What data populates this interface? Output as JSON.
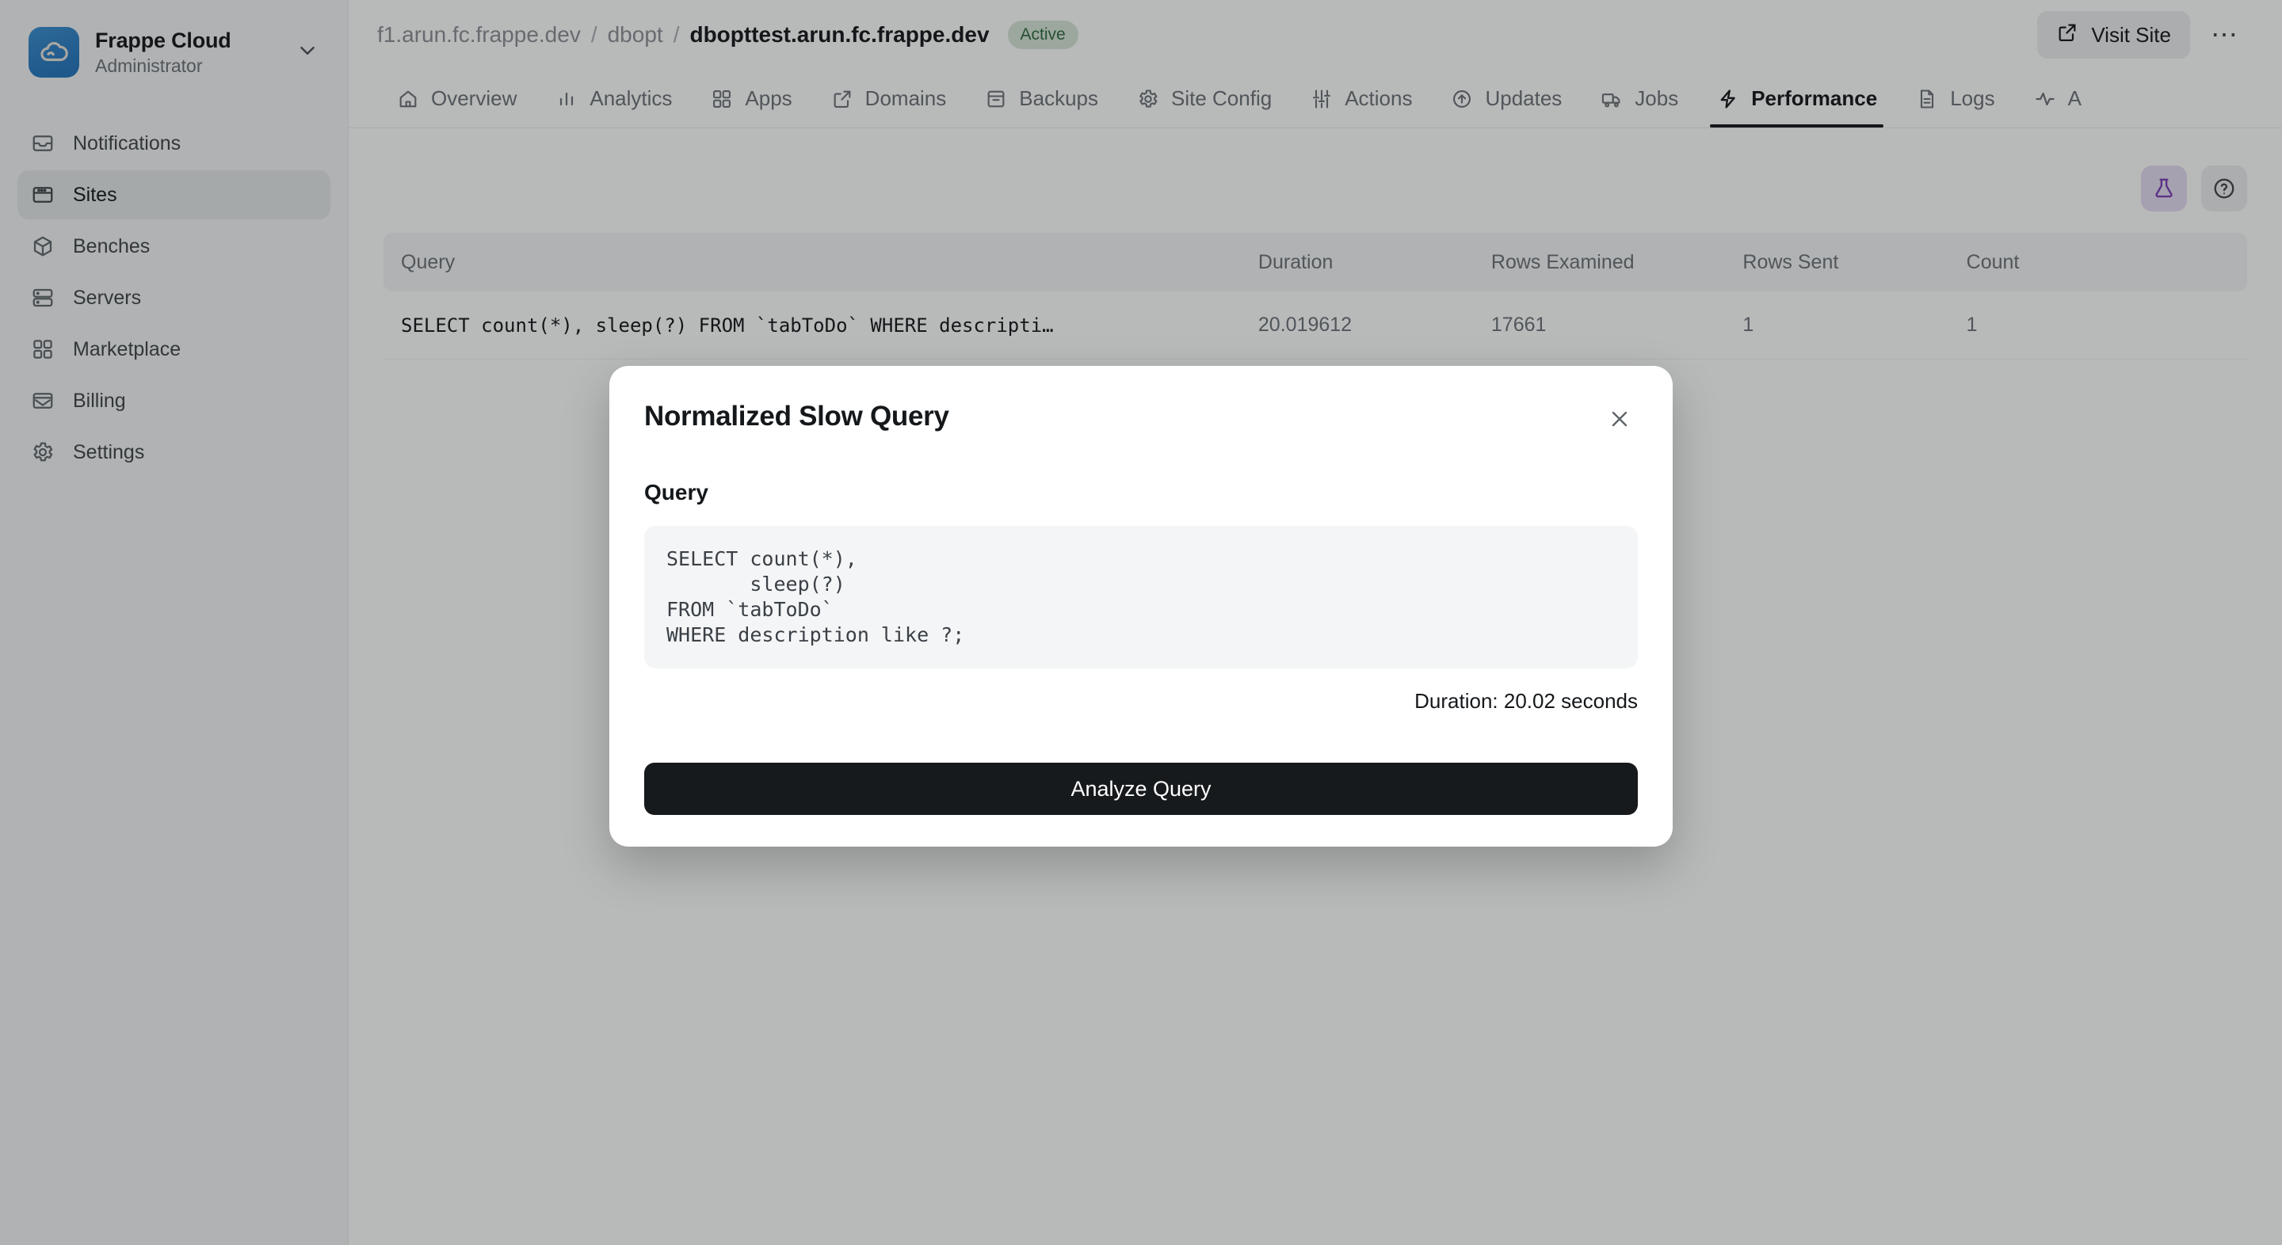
{
  "sidebar": {
    "brand": {
      "title": "Frappe Cloud",
      "subtitle": "Administrator",
      "logo_icon": "cloud-icon",
      "chevron_icon": "chevron-down-icon"
    },
    "items": [
      {
        "label": "Notifications",
        "icon": "inbox-icon",
        "active": false
      },
      {
        "label": "Sites",
        "icon": "window-icon",
        "active": true
      },
      {
        "label": "Benches",
        "icon": "package-icon",
        "active": false
      },
      {
        "label": "Servers",
        "icon": "server-icon",
        "active": false
      },
      {
        "label": "Marketplace",
        "icon": "grid-icon",
        "active": false
      },
      {
        "label": "Billing",
        "icon": "envelope-icon",
        "active": false
      },
      {
        "label": "Settings",
        "icon": "gear-icon",
        "active": false
      }
    ]
  },
  "topbar": {
    "breadcrumbs": [
      {
        "label": "f1.arun.fc.frappe.dev",
        "current": false
      },
      {
        "label": "dbopt",
        "current": false
      },
      {
        "label": "dbopttest.arun.fc.frappe.dev",
        "current": true
      }
    ],
    "separator": "/",
    "status_badge": "Active",
    "visit_site_label": "Visit Site",
    "visit_site_icon": "external-link-icon",
    "more_icon": "ellipsis-icon"
  },
  "tabs": [
    {
      "label": "Overview",
      "icon": "home-icon",
      "active": false
    },
    {
      "label": "Analytics",
      "icon": "bar-chart-icon",
      "active": false
    },
    {
      "label": "Apps",
      "icon": "grid-icon",
      "active": false
    },
    {
      "label": "Domains",
      "icon": "external-link-icon",
      "active": false
    },
    {
      "label": "Backups",
      "icon": "archive-icon",
      "active": false
    },
    {
      "label": "Site Config",
      "icon": "gear-icon",
      "active": false
    },
    {
      "label": "Actions",
      "icon": "sliders-icon",
      "active": false
    },
    {
      "label": "Updates",
      "icon": "arrow-up-circle-icon",
      "active": false
    },
    {
      "label": "Jobs",
      "icon": "truck-icon",
      "active": false
    },
    {
      "label": "Performance",
      "icon": "bolt-icon",
      "active": true
    },
    {
      "label": "Logs",
      "icon": "file-text-icon",
      "active": false
    },
    {
      "label": "A",
      "icon": "activity-icon",
      "active": false
    }
  ],
  "toolbar": {
    "lab_icon": "flask-icon",
    "help_icon": "question-circle-icon",
    "lab_accent": "#7c3fb8"
  },
  "table": {
    "columns": [
      "Query",
      "Duration",
      "Rows Examined",
      "Rows Sent",
      "Count"
    ],
    "rows": [
      {
        "query": "SELECT count(*), sleep(?) FROM `tabToDo` WHERE descripti…",
        "duration": "20.019612",
        "rows_examined": "17661",
        "rows_sent": "1",
        "count": "1"
      }
    ]
  },
  "modal": {
    "title": "Normalized Slow Query",
    "close_icon": "close-icon",
    "query_label": "Query",
    "query_sql": "SELECT count(*),\n       sleep(?)\nFROM `tabToDo`\nWHERE description like ?;",
    "duration_text": "Duration: 20.02 seconds",
    "analyze_label": "Analyze Query"
  }
}
